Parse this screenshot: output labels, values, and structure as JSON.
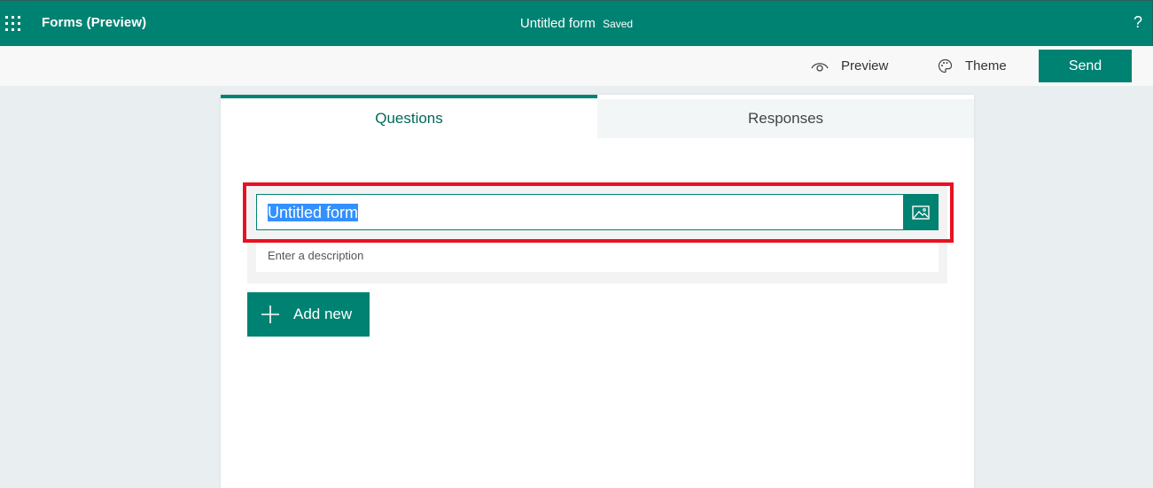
{
  "topbar": {
    "app_name": "Forms (Preview)",
    "form_name": "Untitled form",
    "save_status": "Saved",
    "help_glyph": "?"
  },
  "commandbar": {
    "preview_label": "Preview",
    "theme_label": "Theme",
    "send_label": "Send"
  },
  "tabs": [
    {
      "label": "Questions",
      "active": true
    },
    {
      "label": "Responses",
      "active": false
    }
  ],
  "form": {
    "title_value": "Untitled form",
    "description_placeholder": "Enter a description",
    "add_new_label": "Add new"
  },
  "colors": {
    "brand": "#008272",
    "highlight": "#e81123",
    "selection": "#3390ff"
  },
  "icons": [
    "app-launcher-icon",
    "help-icon",
    "eye-icon",
    "palette-icon",
    "image-icon",
    "plus-icon"
  ]
}
